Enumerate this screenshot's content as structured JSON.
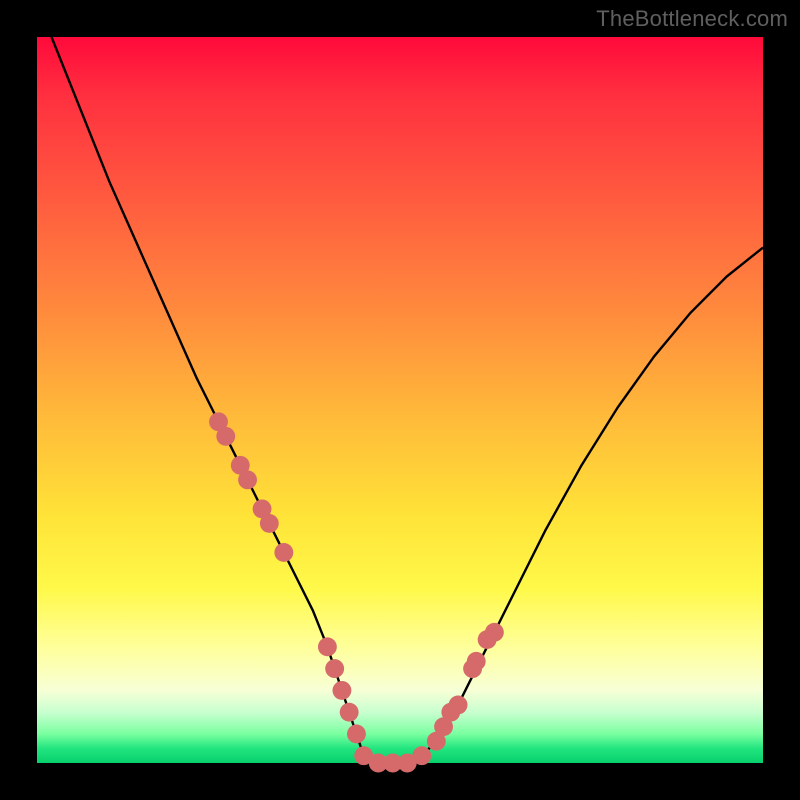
{
  "watermark": "TheBottleneck.com",
  "colors": {
    "frame": "#000000",
    "gradient_top": "#ff0a3b",
    "gradient_mid": "#ffe338",
    "gradient_bottom": "#07d06c",
    "curve": "#000000",
    "marker_fill": "#d66a6a",
    "marker_stroke": "#c65a5a"
  },
  "chart_data": {
    "type": "line",
    "title": "",
    "xlabel": "",
    "ylabel": "",
    "xlim": [
      0,
      100
    ],
    "ylim": [
      0,
      100
    ],
    "curve_x": [
      2,
      6,
      10,
      14,
      18,
      22,
      24,
      26,
      28,
      30,
      32,
      34,
      36,
      38,
      40,
      41,
      42,
      43,
      44,
      45,
      47,
      49,
      51,
      53,
      55,
      58,
      62,
      66,
      70,
      75,
      80,
      85,
      90,
      95,
      100
    ],
    "curve_y": [
      100,
      90,
      80,
      71,
      62,
      53,
      49,
      45,
      41,
      37,
      33,
      29,
      25,
      21,
      16,
      13,
      10,
      7,
      4,
      1,
      0,
      0,
      0,
      1,
      3,
      8,
      16,
      24,
      32,
      41,
      49,
      56,
      62,
      67,
      71
    ],
    "marker_x": [
      25,
      26,
      28,
      29,
      31,
      32,
      34,
      40,
      41,
      42,
      43,
      44,
      45,
      47,
      49,
      51,
      53,
      55,
      56,
      57,
      58,
      60,
      60.5,
      62,
      63
    ],
    "marker_y": [
      47,
      45,
      41,
      39,
      35,
      33,
      29,
      16,
      13,
      10,
      7,
      4,
      1,
      0,
      0,
      0,
      1,
      3,
      5,
      7,
      8,
      13,
      14,
      17,
      18
    ],
    "marker_radius_pct": 1.3
  }
}
